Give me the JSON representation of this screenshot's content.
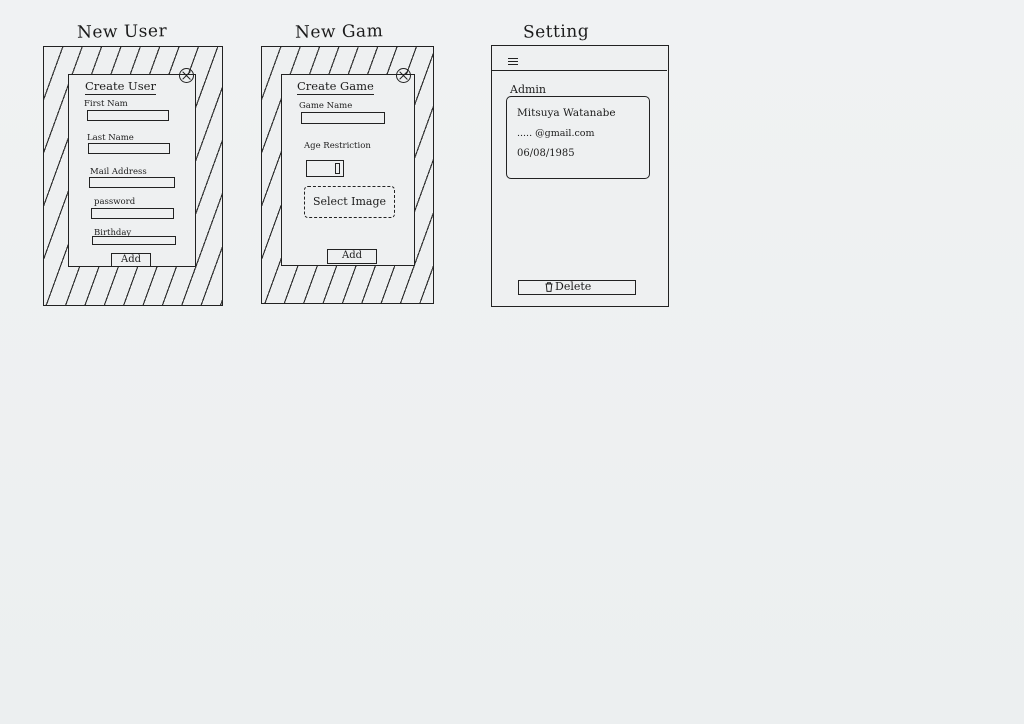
{
  "screens": {
    "new_user": {
      "title": "New User",
      "dialog_title": "Create User",
      "fields": [
        {
          "label": "First Nam"
        },
        {
          "label": "Last Name"
        },
        {
          "label": "Mail Address"
        },
        {
          "label": "password"
        },
        {
          "label": "Birthday"
        }
      ],
      "add_label": "Add",
      "close_icon": "close-icon"
    },
    "new_game": {
      "title": "New Gam",
      "dialog_title": "Create Game",
      "game_name_label": "Game Name",
      "age_label": "Age Restriction",
      "select_image_label": "Select Image",
      "add_label": "Add",
      "close_icon": "close-icon"
    },
    "setting": {
      "title": "Setting",
      "menu_icon": "menu-icon",
      "section_label": "Admin",
      "profile": {
        "name": "Mitsuya Watanabe",
        "email": "..... @gmail.com",
        "birthday": "06/08/1985"
      },
      "delete_label": "Delete",
      "delete_icon": "trash-icon"
    }
  }
}
